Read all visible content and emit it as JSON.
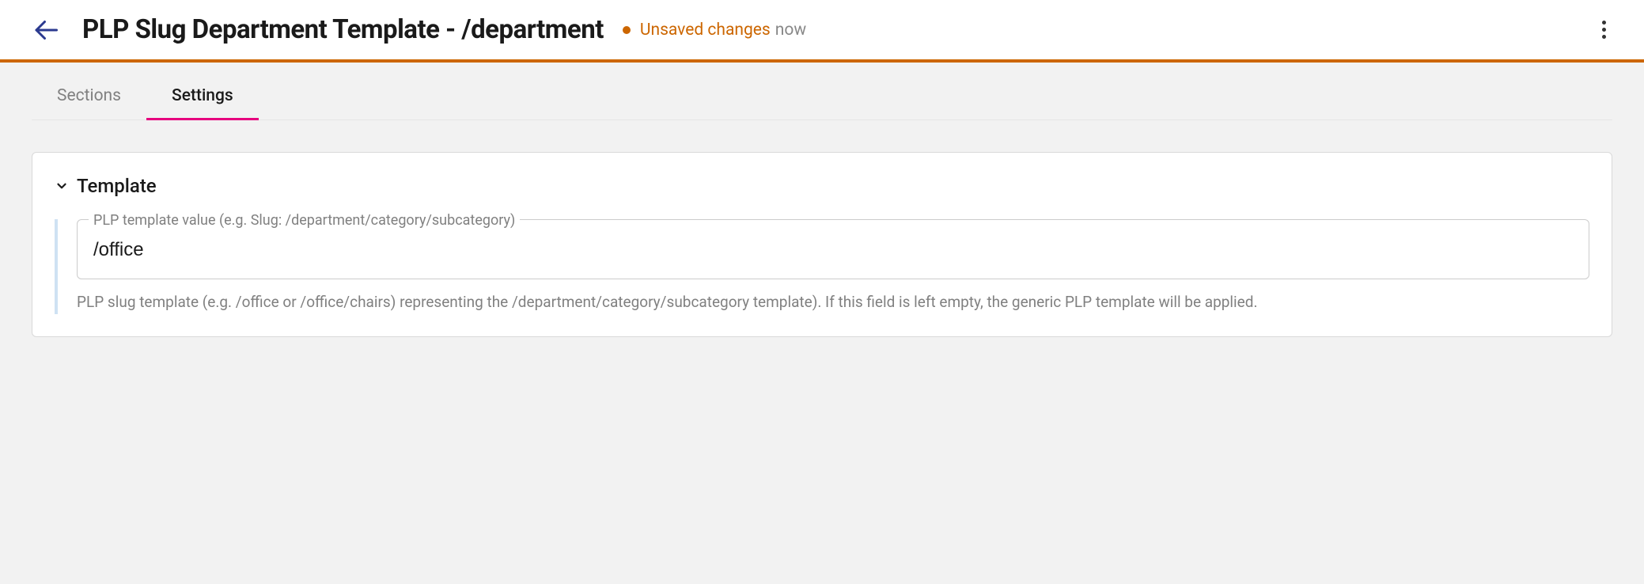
{
  "header": {
    "title": "PLP Slug Department Template - /department",
    "status_text": "Unsaved changes",
    "status_time": "now"
  },
  "tabs": [
    {
      "label": "Sections",
      "active": false
    },
    {
      "label": "Settings",
      "active": true
    }
  ],
  "panel": {
    "section_title": "Template",
    "field": {
      "label": "PLP template value (e.g. Slug: /department/category/subcategory)",
      "value": "/office",
      "help": "PLP slug template (e.g. /office or /office/chairs) representing the /department/category/subcategory template). If this field is left empty, the generic PLP template will be applied."
    }
  }
}
